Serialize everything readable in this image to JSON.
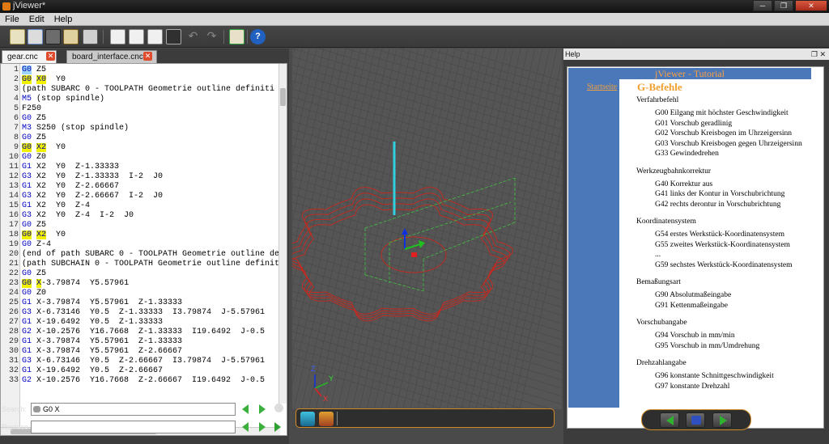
{
  "window": {
    "title": "jViewer*"
  },
  "menu": [
    "File",
    "Edit",
    "Help"
  ],
  "tabs": [
    {
      "label": "gear.cnc",
      "active": true
    },
    {
      "label": "board_interface.cnc",
      "active": false
    }
  ],
  "code_lines": [
    {
      "n": "1",
      "parts": [
        [
          "hl2",
          "G0"
        ],
        [
          "t",
          " Z5"
        ]
      ]
    },
    {
      "n": "2",
      "parts": [
        [
          "hl",
          "G0"
        ],
        [
          "t",
          " "
        ],
        [
          "hl",
          "X0"
        ],
        [
          "t",
          "  Y0"
        ]
      ]
    },
    {
      "n": "3",
      "parts": [
        [
          "t",
          "(path SUBARC 0 - TOOLPATH Geometrie outline definiti"
        ]
      ]
    },
    {
      "n": "4",
      "parts": [
        [
          "m",
          "M5"
        ],
        [
          "t",
          " (stop spindle)"
        ]
      ]
    },
    {
      "n": "5",
      "parts": [
        [
          "t",
          "F250"
        ]
      ]
    },
    {
      "n": "6",
      "parts": [
        [
          "g",
          "G0"
        ],
        [
          "t",
          " Z5"
        ]
      ]
    },
    {
      "n": "7",
      "parts": [
        [
          "m",
          "M3"
        ],
        [
          "t",
          " S250 (stop spindle)"
        ]
      ]
    },
    {
      "n": "8",
      "parts": [
        [
          "g",
          "G0"
        ],
        [
          "t",
          " Z5"
        ]
      ]
    },
    {
      "n": "9",
      "parts": [
        [
          "hl",
          "G0"
        ],
        [
          "t",
          " "
        ],
        [
          "hl",
          "X2"
        ],
        [
          "t",
          "  Y0"
        ]
      ]
    },
    {
      "n": "10",
      "parts": [
        [
          "g",
          "G0"
        ],
        [
          "t",
          " Z0"
        ]
      ]
    },
    {
      "n": "11",
      "parts": [
        [
          "g",
          "G1"
        ],
        [
          "t",
          " X2  Y0  Z-1.33333"
        ]
      ]
    },
    {
      "n": "12",
      "parts": [
        [
          "g",
          "G3"
        ],
        [
          "t",
          " X2  Y0  Z-1.33333  I-2  J0"
        ]
      ]
    },
    {
      "n": "13",
      "parts": [
        [
          "g",
          "G1"
        ],
        [
          "t",
          " X2  Y0  Z-2.66667"
        ]
      ]
    },
    {
      "n": "14",
      "parts": [
        [
          "g",
          "G3"
        ],
        [
          "t",
          " X2  Y0  Z-2.66667  I-2  J0"
        ]
      ]
    },
    {
      "n": "15",
      "parts": [
        [
          "g",
          "G1"
        ],
        [
          "t",
          " X2  Y0  Z-4"
        ]
      ]
    },
    {
      "n": "16",
      "parts": [
        [
          "g",
          "G3"
        ],
        [
          "t",
          " X2  Y0  Z-4  I-2  J0"
        ]
      ]
    },
    {
      "n": "17",
      "parts": [
        [
          "g",
          "G0"
        ],
        [
          "t",
          " Z5"
        ]
      ]
    },
    {
      "n": "18",
      "parts": [
        [
          "hl",
          "G0"
        ],
        [
          "t",
          " "
        ],
        [
          "hl",
          "X2"
        ],
        [
          "t",
          "  Y0"
        ]
      ]
    },
    {
      "n": "19",
      "parts": [
        [
          "g",
          "G0"
        ],
        [
          "t",
          " Z-4"
        ]
      ]
    },
    {
      "n": "20",
      "parts": [
        [
          "t",
          "(end of path SUBARC 0 - TOOLPATH Geometrie outline de"
        ]
      ]
    },
    {
      "n": "21",
      "parts": [
        [
          "t",
          "(path SUBCHAIN 0 - TOOLPATH Geometrie outline definit"
        ]
      ]
    },
    {
      "n": "22",
      "parts": [
        [
          "g",
          "G0"
        ],
        [
          "t",
          " Z5"
        ]
      ]
    },
    {
      "n": "23",
      "parts": [
        [
          "hl",
          "G0"
        ],
        [
          "t",
          " "
        ],
        [
          "hl",
          "X"
        ],
        [
          "t",
          "-3.79874  Y5.57961"
        ]
      ]
    },
    {
      "n": "24",
      "parts": [
        [
          "g",
          "G0"
        ],
        [
          "t",
          " Z0"
        ]
      ]
    },
    {
      "n": "25",
      "parts": [
        [
          "g",
          "G1"
        ],
        [
          "t",
          " X-3.79874  Y5.57961  Z-1.33333"
        ]
      ]
    },
    {
      "n": "26",
      "parts": [
        [
          "g",
          "G3"
        ],
        [
          "t",
          " X-6.73146  Y0.5  Z-1.33333  I3.79874  J-5.57961"
        ]
      ]
    },
    {
      "n": "27",
      "parts": [
        [
          "g",
          "G1"
        ],
        [
          "t",
          " X-19.6492  Y0.5  Z-1.33333"
        ]
      ]
    },
    {
      "n": "28",
      "parts": [
        [
          "g",
          "G2"
        ],
        [
          "t",
          " X-10.2576  Y16.7668  Z-1.33333  I19.6492  J-0.5"
        ]
      ]
    },
    {
      "n": "29",
      "parts": [
        [
          "g",
          "G1"
        ],
        [
          "t",
          " X-3.79874  Y5.57961  Z-1.33333"
        ]
      ]
    },
    {
      "n": "30",
      "parts": [
        [
          "g",
          "G1"
        ],
        [
          "t",
          " X-3.79874  Y5.57961  Z-2.66667"
        ]
      ]
    },
    {
      "n": "31",
      "parts": [
        [
          "g",
          "G3"
        ],
        [
          "t",
          " X-6.73146  Y0.5  Z-2.66667  I3.79874  J-5.57961"
        ]
      ]
    },
    {
      "n": "32",
      "parts": [
        [
          "g",
          "G1"
        ],
        [
          "t",
          " X-19.6492  Y0.5  Z-2.66667"
        ]
      ]
    },
    {
      "n": "33",
      "parts": [
        [
          "g",
          "G2"
        ],
        [
          "t",
          " X-10.2576  Y16.7668  Z-2.66667  I19.6492  J-0.5"
        ]
      ]
    }
  ],
  "search": {
    "label": "Search:",
    "value": "G0 X"
  },
  "replace": {
    "label": "Replace:",
    "value": ""
  },
  "viewport": {
    "axis_labels": {
      "x": "X",
      "y": "Y",
      "z": "Z"
    },
    "colors": {
      "toolpath": "#c8281e",
      "tool": "#30d0e0",
      "bbox": "#40c040"
    }
  },
  "help": {
    "panel_title": "Help",
    "banner": "jViewer - Tutorial",
    "side_link": "Startseite",
    "heading": "G-Befehle",
    "sections": [
      {
        "title": "Verfahrbefehl",
        "items": [
          "G00 Eilgang mit höchster Geschwindigkeit",
          "G01 Vorschub geradlinig",
          "G02 Vorschub Kreisbogen im Uhrzeigersinn",
          "G03 Vorschub Kreisbogen gegen Uhrzeigersinn",
          "G33 Gewindedrehen"
        ]
      },
      {
        "title": "Werkzeugbahnkorrektur",
        "items": [
          "G40 Korrektur aus",
          "G41 links der Kontur in Vorschubrichtung",
          "G42 rechts derontur in Vorschubrichtung"
        ]
      },
      {
        "title": "Koordinatensystem",
        "items": [
          "G54 erstes Werkstück-Koordinatensystem",
          "G55 zweites Werkstück-Koordinatensystem",
          "...",
          "G59 sechstes Werkstück-Koordinatensystem"
        ]
      },
      {
        "title": "Bemaßungsart",
        "items": [
          "G90 Absolutmaßeingabe",
          "G91 Kettenmaßeingabe"
        ]
      },
      {
        "title": "Vorschubangabe",
        "items": [
          "G94 Vorschub in mm/min",
          "G95 Vorschub in mm/Umdrehung"
        ]
      },
      {
        "title": "Drehzahlangabe",
        "items": [
          "G96 konstante Schnittgeschwindigkeit",
          "G97 konstante Drehzahl"
        ]
      }
    ]
  }
}
